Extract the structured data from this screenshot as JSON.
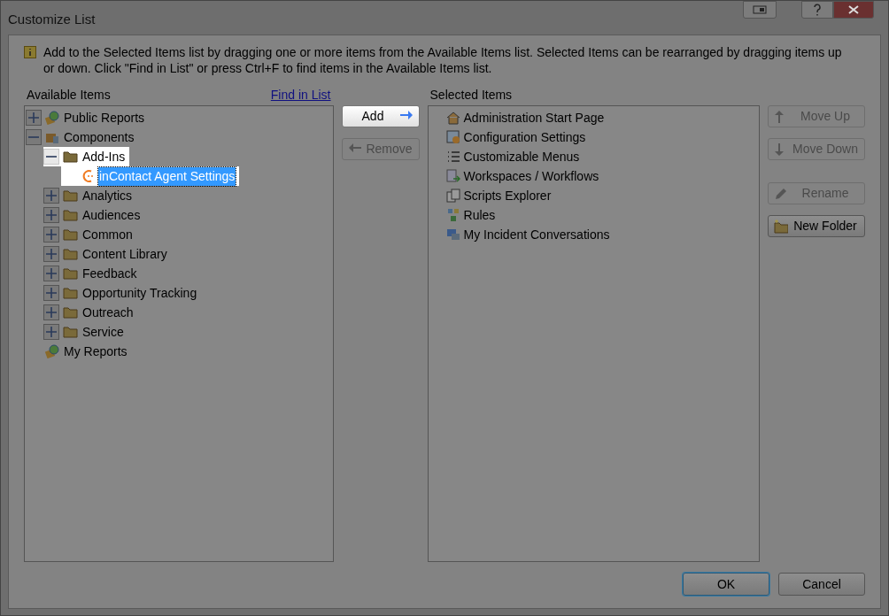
{
  "window": {
    "title": "Customize List"
  },
  "info": "Add to the Selected Items list by dragging one or more items from the Available Items list. Selected Items can be rearranged by dragging items up or down. Click \"Find in List\" or press Ctrl+F to find items in the Available Items list.",
  "available": {
    "label": "Available Items",
    "find_link": "Find in List",
    "tree": [
      {
        "label": "Public Reports",
        "kind": "report",
        "expanded": false,
        "selected": false,
        "highlighted": false
      },
      {
        "label": "Components",
        "kind": "component",
        "expanded": true,
        "selected": false,
        "highlighted": false,
        "children": [
          {
            "label": "Add-Ins",
            "kind": "folder",
            "expanded": true,
            "selected": false,
            "highlighted": true,
            "children": [
              {
                "label": "inContact Agent Settings",
                "kind": "plugin",
                "selected": true,
                "highlighted": true
              }
            ]
          },
          {
            "label": "Analytics",
            "kind": "folder",
            "expanded": false,
            "selected": false,
            "highlighted": false
          },
          {
            "label": "Audiences",
            "kind": "folder",
            "expanded": false,
            "selected": false,
            "highlighted": false
          },
          {
            "label": "Common",
            "kind": "folder",
            "expanded": false,
            "selected": false,
            "highlighted": false
          },
          {
            "label": "Content Library",
            "kind": "folder",
            "expanded": false,
            "selected": false,
            "highlighted": false
          },
          {
            "label": "Feedback",
            "kind": "folder",
            "expanded": false,
            "selected": false,
            "highlighted": false
          },
          {
            "label": "Opportunity Tracking",
            "kind": "folder",
            "expanded": false,
            "selected": false,
            "highlighted": false
          },
          {
            "label": "Outreach",
            "kind": "folder",
            "expanded": false,
            "selected": false,
            "highlighted": false
          },
          {
            "label": "Service",
            "kind": "folder",
            "expanded": false,
            "selected": false,
            "highlighted": false
          }
        ]
      },
      {
        "label": "My Reports",
        "kind": "report",
        "selected": false,
        "highlighted": false
      }
    ]
  },
  "transfer_buttons": [
    {
      "label": "Add",
      "kind": "add",
      "disabled": false
    },
    {
      "label": "Remove",
      "kind": "remove",
      "disabled": true
    }
  ],
  "selected": {
    "label": "Selected Items",
    "items": [
      {
        "label": "Administration Start Page",
        "kind": "home"
      },
      {
        "label": "Configuration Settings",
        "kind": "config"
      },
      {
        "label": "Customizable Menus",
        "kind": "menu"
      },
      {
        "label": "Workspaces / Workflows",
        "kind": "workspace"
      },
      {
        "label": "Scripts Explorer",
        "kind": "scripts"
      },
      {
        "label": "Rules",
        "kind": "rules"
      },
      {
        "label": "My Incident Conversations",
        "kind": "chat"
      }
    ]
  },
  "side_buttons": [
    {
      "label": "Move Up",
      "kind": "up",
      "disabled": true
    },
    {
      "label": "Move Down",
      "kind": "down",
      "disabled": true
    },
    {
      "label": "Rename",
      "kind": "rename",
      "disabled": true
    },
    {
      "label": "New Folder",
      "kind": "folder",
      "disabled": false
    }
  ],
  "footer_buttons": [
    {
      "label": "OK",
      "default": true
    },
    {
      "label": "Cancel",
      "default": false
    }
  ]
}
